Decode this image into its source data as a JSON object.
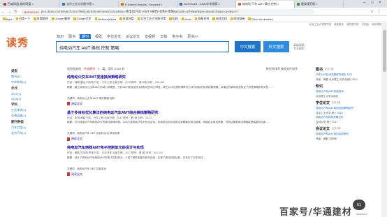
{
  "browser": {
    "tabs": [
      {
        "title": "百度网盘-我的网盘 ×",
        "active": false
      },
      {
        "title": "北京工业大学图书馆 ×",
        "active": false
      },
      {
        "title": "E Search Results - Keyword ×",
        "active": false
      },
      {
        "title": "SCHOLAR - CNKI学术搜索 ×",
        "active": false
      },
      {
        "title": "纯电动 汽车 AMT 换挡 控制 ×",
        "active": true
      },
      {
        "title": "题录规范版 ×",
        "active": false
      }
    ],
    "not_secure": "Not secure",
    "url": "jour.duxiu.com/searchJour?field=&channel=searchJour&sw=纯电动汽车+AMT+换挡+控制+策略&ecode=utf-8&edtype=&searchtype=&view=0",
    "bookmarks": [
      "Apps",
      "百度一下",
      "百度翻译",
      "Google 翻译",
      "Google学术",
      "Wolfram|Alpha",
      "百度网盘",
      "北京工业大学图书馆",
      "知网",
      "Mooc",
      "维基百科",
      "在线文档",
      "网站链接",
      "Other bookmarks"
    ]
  },
  "site": {
    "toplinks": [
      "北京工业大学图书馆",
      "读秀首页",
      "我的图书馆",
      "手机版",
      "网站导航"
    ],
    "logo": "读秀",
    "channels": [
      "知识",
      "图书",
      "期刊",
      "报纸",
      "学位论文",
      "会议论文",
      "音视频",
      "文档",
      "电子书",
      "更多>>"
    ],
    "active_channel": "期刊",
    "query": "纯电动汽车 AMT 换挡 控制 策略",
    "btn_search_in": "中文搜索",
    "btn_search_out": "外文搜索",
    "adv_links": [
      "高级搜索",
      "专业搜索"
    ]
  },
  "sidebar": {
    "sections": [
      {
        "title": "类型",
        "items": [
          "期刊(4)",
          "中华学术(2)"
        ]
      },
      {
        "title": "年代",
        "items": [
          "2017(3)",
          "2016(1)"
        ]
      },
      {
        "title": "学科",
        "items": [
          "工业技术(4)",
          "交通运输(1)"
        ]
      },
      {
        "title": "期刊种类",
        "items": [
          "汽车工程(1)",
          "北京汽车(1)"
        ]
      }
    ]
  },
  "sortbar": {
    "prefix": "找到相关的",
    "query_label": "中文期刊",
    "count": "4",
    "suffix": "篇，用时 0.005 秒",
    "options": "按时间排序  按相关性排序"
  },
  "results": [
    {
      "title": "纯电动公交车AMT变速换挡策略研究",
      "meta": "作者：黄鹤,雷征,刘永刚  刊名：汽车工程  出版日期：2016  期号：第10卷  页码：344-345",
      "abstract": "摘要：建立纯电动公交车AMT的动力学模型，分析AMT换挡过程中各阶段的动力特性，提出以冲击度和滑摩功为评价指标的换挡控制策略，并通过仿真和实验验证了所提策略的有效性……",
      "keywords": "关键词：纯电动公交车  AMT  换挡策略  控制",
      "pdf": "阅读全文"
    },
    {
      "title": "基于多目标优化算法的纯电动汽车AMT综合换挡策略研究",
      "meta": "作者：朱翔,黄鹤  刊名：汽车工程  出版日期：2017  期号：第7卷  页码：24-31",
      "abstract": "摘要：针对纯电动汽车两挡AMT的换挡规律问题，以动力性和经济性为优化目标，采用多目标优化算法求解最优换挡规律，构建综合换挡策略，仿真结果表明该策略能提高整车性能……",
      "keywords": "关键词：纯电动汽车  AMT  多目标优化  换挡规律",
      "pdf": "阅读全文"
    },
    {
      "title": "纯电动汽车两挡AMT电子控制单元的设计与实现",
      "meta": "作者：黄鹤,刘永刚,李宝  刊名：北京汽车  出版日期：2017  期号：第1卷  页码：415-422",
      "abstract": "摘要：设计了纯电动汽车两挡AMT的电子控制单元，介绍了硬件电路与软件结构，实现了换挡控制功能，并进行了实车测试……",
      "keywords": "关键词：纯电动汽车  AMT  控制单元",
      "pdf": "阅读全文"
    }
  ],
  "rightcol": [
    {
      "title": "图书",
      "count": "相关1篇",
      "items": [
        "汽车AMT技术发展研究报告 2011",
        "作者：黄鹤  北京理工大学出版社 2011"
      ]
    },
    {
      "title": "知识",
      "count": "",
      "items": [
        "纯电动汽车AMT控制技术",
        "北京理工大学出版社"
      ]
    },
    {
      "title": "学位论文",
      "count": "相关5篇",
      "items": [
        "纯电动汽车AMT换挡控制策略研究",
        "北京工业大学 硕士 2016",
        "纯电动汽车换挡策略优化",
        "吉林大学 博士 2017"
      ]
    },
    {
      "title": "会议论文",
      "count": "相关2篇",
      "items": [
        "纯电动汽车AMT换挡品质研究",
        "作者：黄鹤 刘永刚"
      ]
    }
  ],
  "widgets": {
    "float_badge": "61",
    "watermark": "百家号/华通建材",
    "date": "2018/10/23"
  }
}
